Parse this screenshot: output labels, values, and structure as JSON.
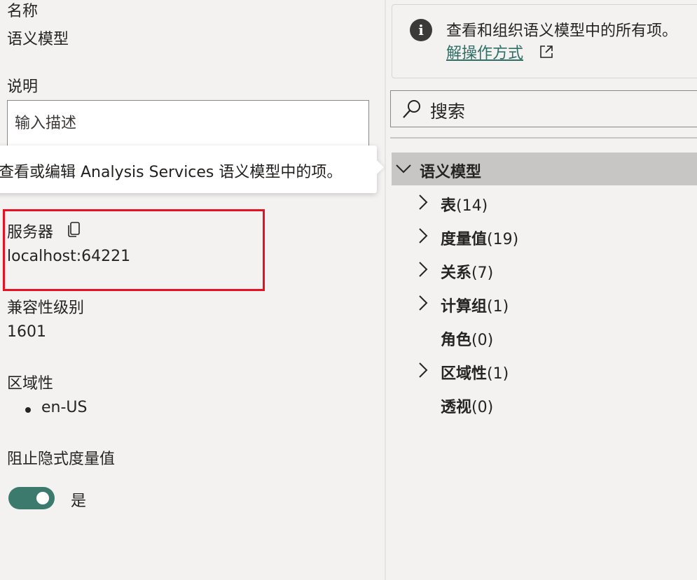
{
  "left_panel": {
    "name_label": "名称",
    "name_value": "语义模型",
    "description_label": "说明",
    "description_placeholder": "输入描述",
    "tooltip_text": "查看或编辑 Analysis Services 语义模型中的项。",
    "server_label": "服务器",
    "server_value": "localhost:64221",
    "compat_label": "兼容性级别",
    "compat_value": "1601",
    "culture_label": "区域性",
    "culture_items": [
      "en-US"
    ],
    "discourage_label": "阻止隐式度量值",
    "toggle_state_label": "是",
    "toggle_on": true
  },
  "right_panel": {
    "info_text": "查看和组织语义模型中的所有项。",
    "info_link": "解操作方式",
    "search_placeholder": "搜索",
    "tree_root": "语义模型",
    "tree_items": [
      {
        "name": "表",
        "count": "(14)",
        "expandable": true
      },
      {
        "name": "度量值",
        "count": "(19)",
        "expandable": true
      },
      {
        "name": "关系",
        "count": "(7)",
        "expandable": true
      },
      {
        "name": "计算组",
        "count": "(1)",
        "expandable": true
      },
      {
        "name": "角色",
        "count": "(0)",
        "expandable": false
      },
      {
        "name": "区域性",
        "count": "(1)",
        "expandable": true
      },
      {
        "name": "透视",
        "count": "(0)",
        "expandable": false
      }
    ]
  },
  "colors": {
    "background": "#f3f2f1",
    "accent": "#3c7a6e",
    "highlight_box": "#e81123",
    "link": "#2f6f66"
  }
}
